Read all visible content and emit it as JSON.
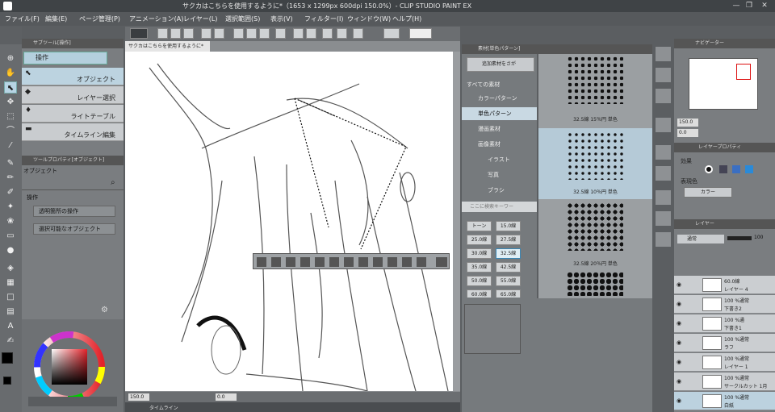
{
  "window": {
    "title": "サクカはこちらを使用するように*（1653 x 1299px 600dpi 150.0%）- CLIP STUDIO PAINT EX",
    "controls": [
      "—",
      "❐",
      "✕"
    ]
  },
  "menu": [
    "ファイル(F)",
    "編集(E)",
    "ページ管理(P)",
    "アニメーション(A)",
    "レイヤー(L)",
    "選択範囲(S)",
    "表示(V)",
    "フィルター(I)",
    "ウィンドウ(W)",
    "ヘルプ(H)"
  ],
  "subtool": {
    "header": "サブツール[操作]",
    "group": "操作",
    "items": [
      "オブジェクト",
      "レイヤー選択",
      "ライトテーブル",
      "タイムライン編集"
    ]
  },
  "toolprop": {
    "header": "ツールプロパティ[オブジェクト]",
    "subtitle": "オブジェクト",
    "section": "操作",
    "field1": "透明箇所の操作",
    "field2": "選択可能なオブジェクト"
  },
  "canvas": {
    "tab": "サクカはこちらを使用するように*",
    "status_zoom": "150.0",
    "status_angle": "0.0",
    "timeline_label": "タイムライン"
  },
  "materials": {
    "header": "素材[単色パターン]",
    "search_button": "追加素材をさが",
    "tree": [
      "すべての素材",
      "カラーパターン",
      "単色パターン",
      "漫画素材",
      "画像素材",
      "イラスト",
      "写真",
      "ブラシ"
    ],
    "search_placeholder": "ここに検索キーワー",
    "chips": [
      "トーン",
      "15.0線",
      "25.0線",
      "27.5線",
      "30.0線",
      "32.5線",
      "35.0線",
      "42.5線",
      "50.0線",
      "55.0線",
      "60.0線",
      "65.0線"
    ],
    "tones": [
      "32.5線 15％円 単色",
      "32.5線 10％円 単色",
      "32.5線 20％円 単色"
    ]
  },
  "navigator": {
    "header": "ナビゲーター",
    "zoom": "150.0",
    "angle": "0.0"
  },
  "layerprop": {
    "header": "レイヤープロパティ",
    "effect_label": "効果",
    "expression_label": "表現色",
    "expression_value": "カラー"
  },
  "layers": {
    "tab": "レイヤー",
    "blend": "通常",
    "opacity": "100",
    "rows": [
      {
        "line1": "60.0線",
        "line2": "レイヤー 4"
      },
      {
        "line1": "100 %通常",
        "line2": "下書き2"
      },
      {
        "line1": "100 %通",
        "line2": "下書き1"
      },
      {
        "line1": "100 %通常",
        "line2": "ラフ"
      },
      {
        "line1": "100 %通常",
        "line2": "レイヤー 1"
      },
      {
        "line1": "100 %通常",
        "line2": "サークルカット 1月"
      },
      {
        "line1": "100 %通常",
        "line2": "白紙"
      }
    ]
  },
  "colors": {
    "main": "#000000",
    "sub": "#ffffff",
    "accent": "#3b86b4"
  }
}
